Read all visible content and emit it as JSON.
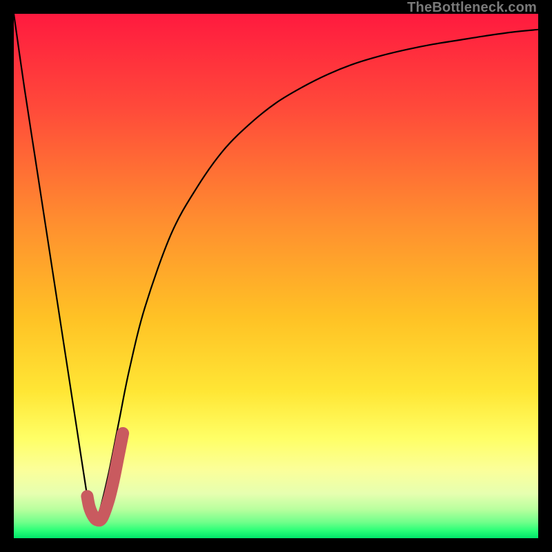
{
  "watermark": "TheBottleneck.com",
  "colors": {
    "frame": "#000000",
    "gradient_stops": [
      {
        "offset": 0.0,
        "color": "#ff1a3f"
      },
      {
        "offset": 0.18,
        "color": "#ff4a3a"
      },
      {
        "offset": 0.4,
        "color": "#ff8f2f"
      },
      {
        "offset": 0.58,
        "color": "#ffc225"
      },
      {
        "offset": 0.72,
        "color": "#ffe635"
      },
      {
        "offset": 0.81,
        "color": "#ffff66"
      },
      {
        "offset": 0.87,
        "color": "#fbff9a"
      },
      {
        "offset": 0.915,
        "color": "#e6ffb0"
      },
      {
        "offset": 0.945,
        "color": "#b8ff9e"
      },
      {
        "offset": 0.97,
        "color": "#6fff8a"
      },
      {
        "offset": 0.985,
        "color": "#2bff78"
      },
      {
        "offset": 1.0,
        "color": "#00e56a"
      }
    ],
    "curve": "#000000",
    "marker": "#c95a5f"
  },
  "chart_data": {
    "type": "line",
    "title": "",
    "xlabel": "",
    "ylabel": "",
    "xlim": [
      0,
      100
    ],
    "ylim": [
      0,
      100
    ],
    "series": [
      {
        "name": "bottleneck-curve",
        "x": [
          0,
          2,
          4,
          6,
          8,
          10,
          12,
          14,
          15,
          16,
          18,
          20,
          22,
          25,
          30,
          35,
          40,
          45,
          50,
          55,
          60,
          65,
          70,
          75,
          80,
          85,
          90,
          95,
          100
        ],
        "y": [
          100,
          86,
          73,
          60,
          47,
          34,
          21,
          8,
          3,
          4,
          12,
          22,
          32,
          44,
          58,
          67,
          74,
          79,
          83,
          86,
          88.5,
          90.5,
          92,
          93.2,
          94.2,
          95,
          95.8,
          96.5,
          97
        ]
      }
    ],
    "marker": {
      "name": "current-value",
      "path_xy": [
        [
          14.0,
          8.0
        ],
        [
          14.4,
          6.0
        ],
        [
          15.0,
          4.5
        ],
        [
          15.8,
          3.5
        ],
        [
          16.8,
          3.8
        ],
        [
          18.0,
          7.0
        ],
        [
          19.0,
          11.0
        ],
        [
          20.0,
          16.0
        ],
        [
          20.8,
          20.0
        ]
      ]
    }
  }
}
